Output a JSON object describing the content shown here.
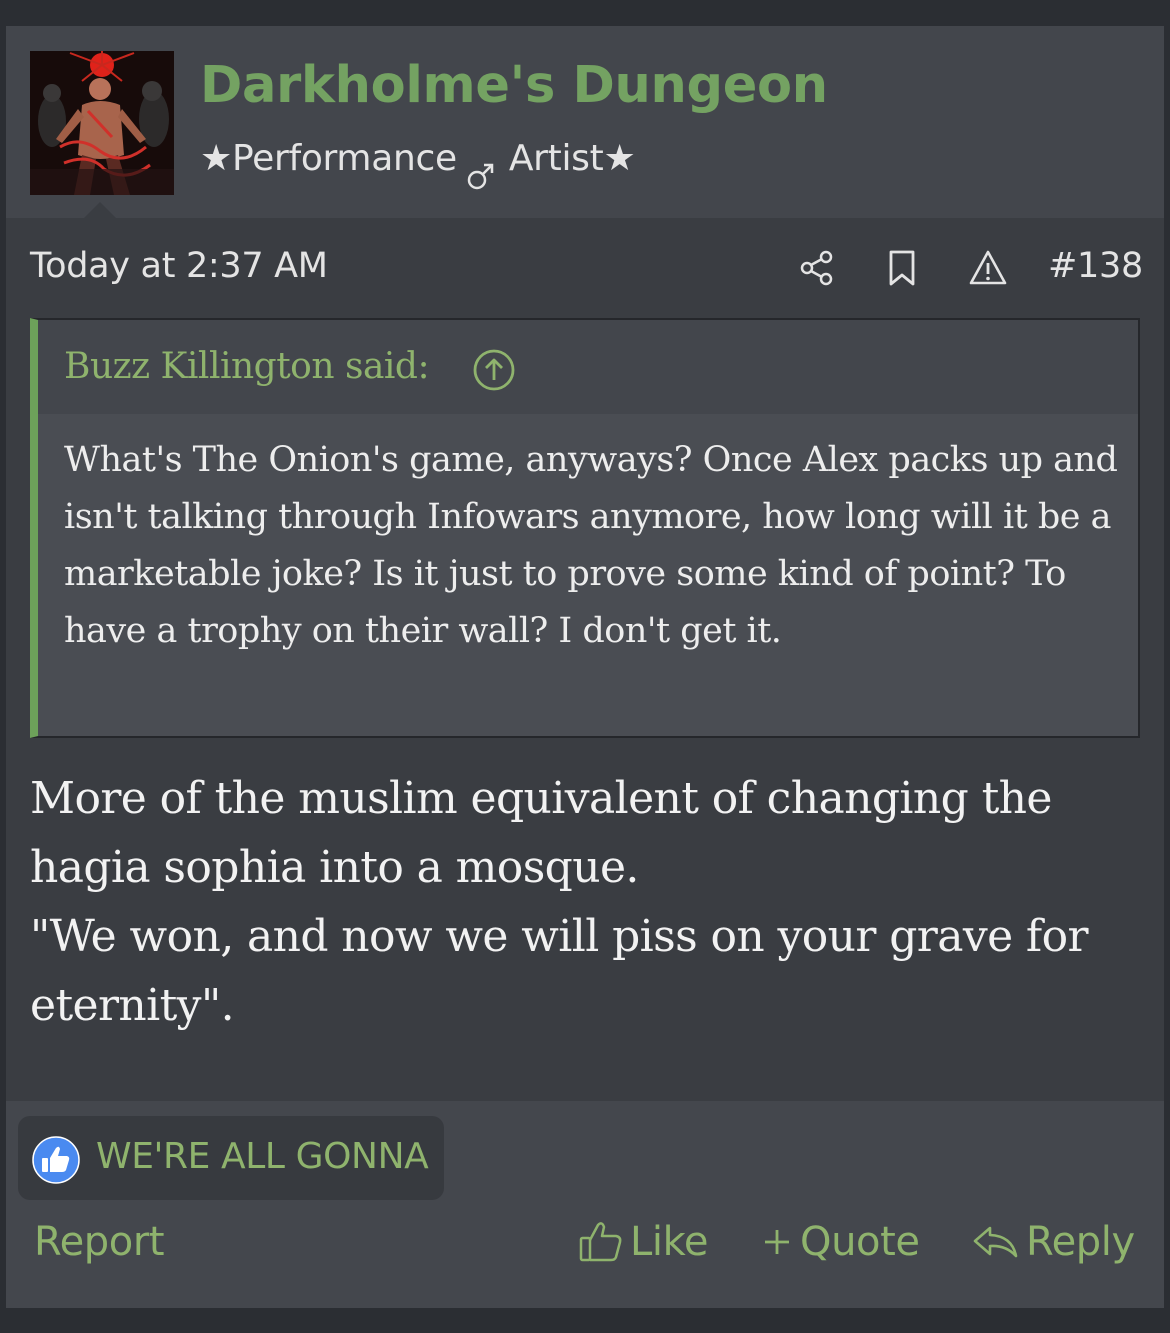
{
  "user": {
    "name": "Darkholme's Dungeon",
    "title_part1": "Performance",
    "title_part2": "Artist",
    "star": "★"
  },
  "post": {
    "date": "Today at 2:37 AM",
    "number": "#138",
    "icons": [
      "share-icon",
      "bookmark-icon",
      "report-warning-icon"
    ]
  },
  "quote": {
    "author": "Buzz Killington said:",
    "text": "What's The Onion's game, anyways? Once Alex packs up and isn't talking through Infowars anymore, how long will it be a marketable joke? Is it just to prove some kind of point? To have a trophy on their wall? I don't get it."
  },
  "message": {
    "line1": "More of the muslim equivalent of changing the",
    "line2": "hagia sophia into a mosque.",
    "line3": "\"We won, and now we will piss on your grave for",
    "line4": "eternity\"."
  },
  "reactions": {
    "label": "WE'RE ALL GONNA",
    "icon": "thumbs-up-icon"
  },
  "actions": {
    "report": "Report",
    "like": "Like",
    "quote": "Quote",
    "reply": "Reply"
  },
  "colors": {
    "accent": "#74a262",
    "background": "#3a3d42",
    "header": "#43464c",
    "quote_bar": "#6da15a"
  }
}
